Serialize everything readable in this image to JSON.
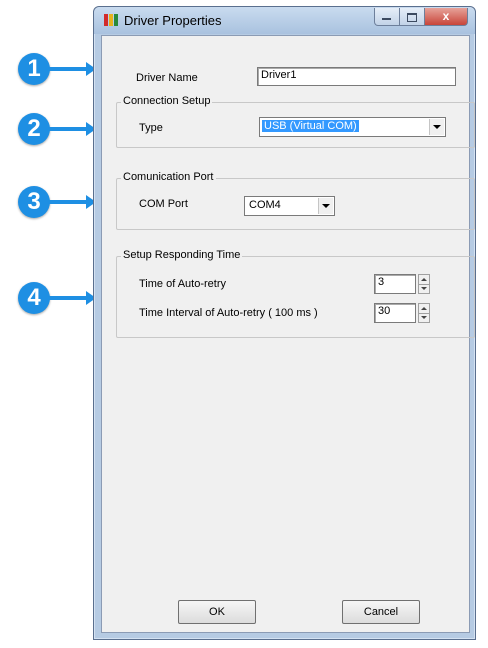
{
  "callouts": [
    "1",
    "2",
    "3",
    "4"
  ],
  "window": {
    "title": "Driver Properties",
    "close_label": "x"
  },
  "driver_name": {
    "label": "Driver Name",
    "value": "Driver1"
  },
  "connection_setup": {
    "title": "Connection Setup",
    "type_label": "Type",
    "type_value": "USB (Virtual COM)"
  },
  "communication_port": {
    "title": "Comunication Port",
    "com_port_label": "COM Port",
    "com_port_value": "COM4"
  },
  "responding_time": {
    "title": "Setup Responding Time",
    "auto_retry_label": "Time of Auto-retry",
    "auto_retry_value": "3",
    "interval_label": "Time Interval of Auto-retry ( 100 ms )",
    "interval_value": "30"
  },
  "buttons": {
    "ok": "OK",
    "cancel": "Cancel"
  },
  "colors": {
    "callout": "#1e8fe3",
    "selection": "#3399ff",
    "frame": "#b6cbe3"
  }
}
